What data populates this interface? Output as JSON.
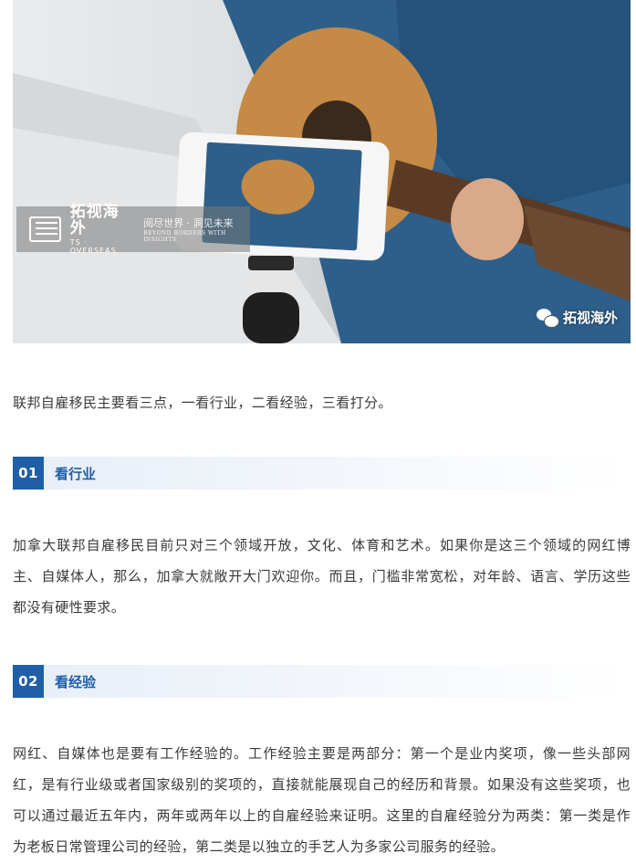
{
  "hero": {
    "watermark_cn": "拓视海外",
    "watermark_en": "TS · OVERSEAS",
    "watermark_slogan": "阅尽世界 · 洞见未来",
    "watermark_slogan_en": "BEYOND BORDERS WITH INSIGHTS",
    "wechat_account": "拓视海外"
  },
  "intro": "联邦自雇移民主要看三点，一看行业，二看经验，三看打分。",
  "sections": [
    {
      "number": "01",
      "title": "看行业",
      "body": "加拿大联邦自雇移民目前只对三个领域开放，文化、体育和艺术。如果你是这三个领域的网红博主、自媒体人，那么，加拿大就敞开大门欢迎你。而且，门槛非常宽松，对年龄、语言、学历这些都没有硬性要求。"
    },
    {
      "number": "02",
      "title": "看经验",
      "body": "网红、自媒体也是要有工作经验的。工作经验主要是两部分：第一个是业内奖项，像一些头部网红，是有行业级或者国家级别的奖项的，直接就能展现自己的经历和背景。如果没有这些奖项，也可以通过最近五年内，两年或两年以上的自雇经验来证明。这里的自雇经验分为两类：第一类是作为老板日常管理公司的经验，第二类是以独立的手艺人为多家公司服务的经验。"
    }
  ],
  "colors": {
    "accent": "#1e5fa8",
    "section_bg": "#e7eef7",
    "text": "#3a3a3a"
  }
}
